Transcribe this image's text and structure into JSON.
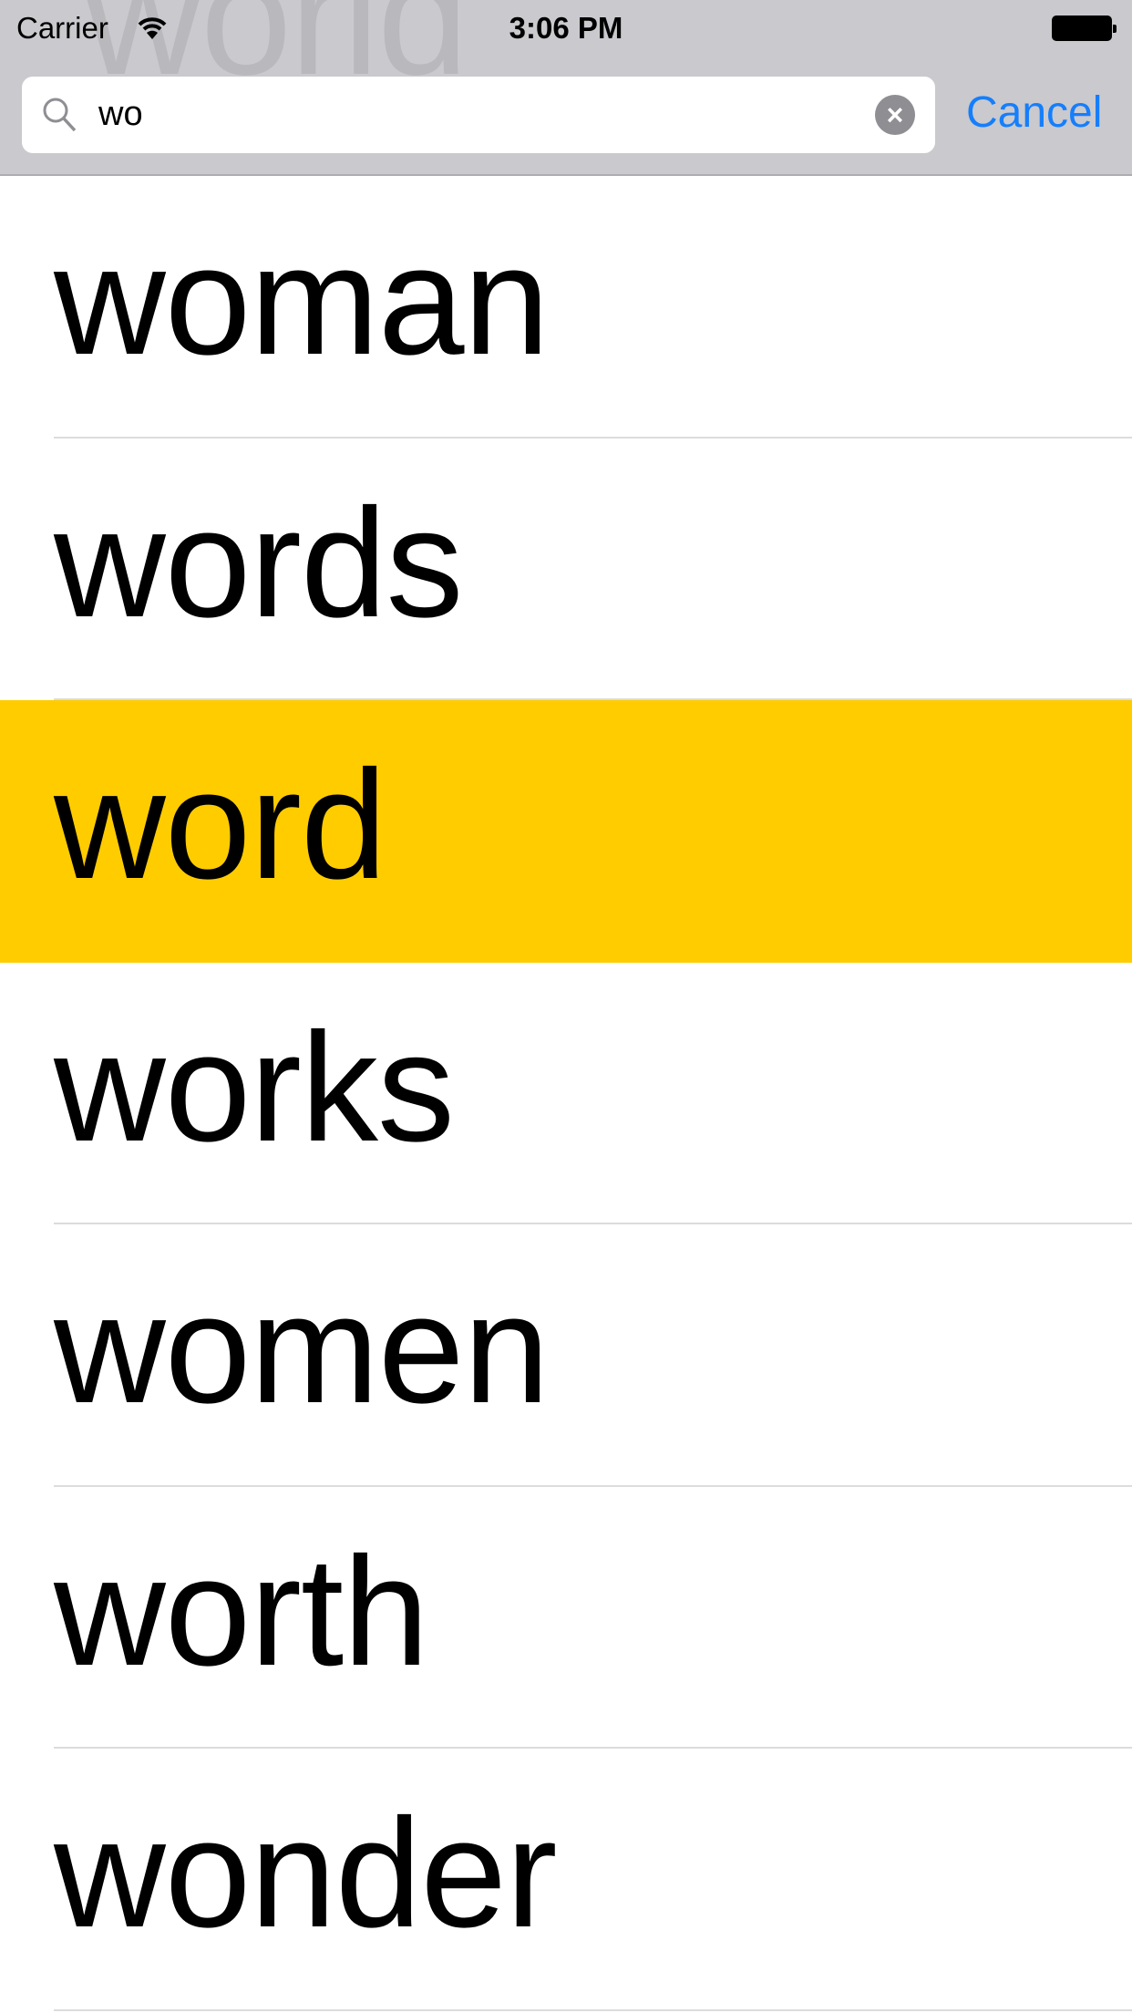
{
  "status_bar": {
    "carrier": "Carrier",
    "time": "3:06 PM"
  },
  "background_word": "world",
  "search": {
    "value": "wo",
    "cancel_label": "Cancel"
  },
  "results": [
    {
      "word": "woman",
      "selected": false
    },
    {
      "word": "words",
      "selected": false
    },
    {
      "word": "word",
      "selected": true
    },
    {
      "word": "works",
      "selected": false
    },
    {
      "word": "women",
      "selected": false
    },
    {
      "word": "worth",
      "selected": false
    },
    {
      "word": "wonder",
      "selected": false
    }
  ],
  "colors": {
    "highlight": "#ffcc00",
    "accent": "#157efb",
    "header": "#c9c9ce"
  }
}
